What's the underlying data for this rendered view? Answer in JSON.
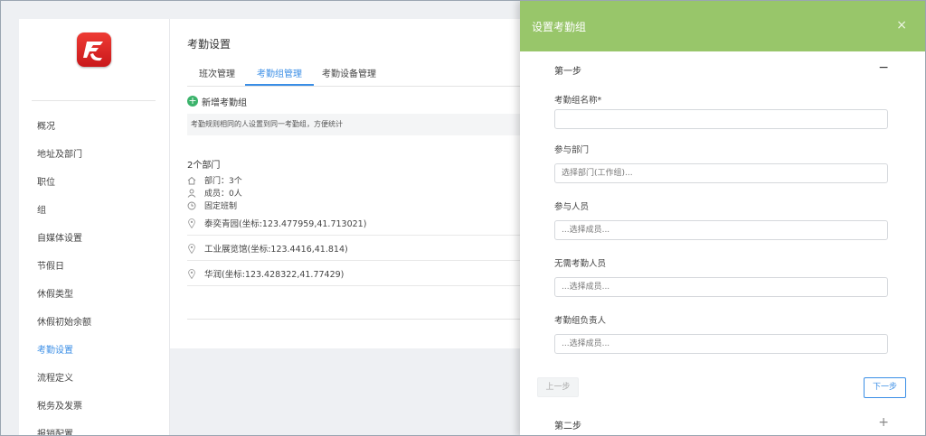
{
  "sidebar": {
    "items": [
      {
        "label": "概况"
      },
      {
        "label": "地址及部门"
      },
      {
        "label": "职位"
      },
      {
        "label": "组"
      },
      {
        "label": "自媒体设置"
      },
      {
        "label": "节假日"
      },
      {
        "label": "休假类型"
      },
      {
        "label": "休假初始余额"
      },
      {
        "label": "考勤设置"
      },
      {
        "label": "流程定义"
      },
      {
        "label": "税务及发票"
      },
      {
        "label": "报销配置"
      }
    ],
    "active_label": "考勤设置",
    "logo_icon": "app-logo-icon"
  },
  "main": {
    "title": "考勤设置",
    "tabs": [
      {
        "label": "班次管理"
      },
      {
        "label": "考勤组管理"
      },
      {
        "label": "考勤设备管理"
      }
    ],
    "active_tab": "考勤组管理",
    "add_group_label": "新增考勤组",
    "hint": "考勤规则相同的人设置到同一考勤组，方便统计",
    "dept_count": "2个部门",
    "info": {
      "departments": "部门：3个",
      "members": "成员：0人",
      "shift": "固定班制"
    },
    "locations": [
      {
        "text": "泰奕青园(坐标:123.477959,41.713021)"
      },
      {
        "text": "工业展览馆(坐标:123.4416,41.814)"
      },
      {
        "text": "华润(坐标:123.428322,41.77429)"
      }
    ]
  },
  "drawer": {
    "title": "设置考勤组",
    "close_icon": "×",
    "step1": {
      "label": "第一步",
      "toggle": "−"
    },
    "fields": [
      {
        "label": "考勤组名称*",
        "value": "",
        "placeholder": ""
      },
      {
        "label": "参与部门",
        "value": "",
        "placeholder": "选择部门(工作组)..."
      },
      {
        "label": "参与人员",
        "value": "",
        "placeholder": "...选择成员..."
      },
      {
        "label": "无需考勤人员",
        "value": "",
        "placeholder": "...选择成员..."
      },
      {
        "label": "考勤组负责人",
        "value": "",
        "placeholder": "...选择成员..."
      }
    ],
    "prev_label": "上一步",
    "next_label": "下一步",
    "step2": {
      "label": "第二步",
      "toggle": "+"
    }
  },
  "colors": {
    "accent": "#3a8ee6",
    "header_green": "#98c66a",
    "add_green": "#3bb36b",
    "logo_red": "#e0262a"
  }
}
